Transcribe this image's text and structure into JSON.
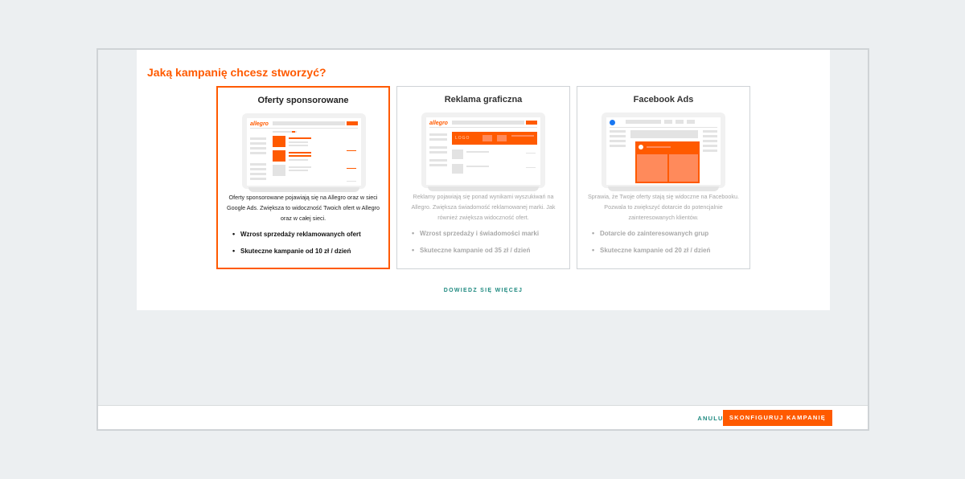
{
  "title": "Jaką kampanię chcesz stworzyć?",
  "cards": [
    {
      "title": "Oferty sponsorowane",
      "logo": "allegro",
      "description": "Oferty sponsorowane pojawiają się na Allegro oraz w sieci Google Ads. Zwiększa to widoczność Twoich ofert w Allegro oraz w całej sieci.",
      "bullets": [
        "Wzrost sprzedaży reklamowanych ofert",
        "Skuteczne kampanie od 10 zł / dzień"
      ]
    },
    {
      "title": "Reklama graficzna",
      "logo": "allegro",
      "banner_text": "LOGO",
      "description": "Reklamy pojawiają się ponad wynikami wyszukiwań na Allegro. Zwiększa świadomość reklamowanej marki. Jak również zwiększa widoczność ofert.",
      "bullets": [
        "Wzrost sprzedaży i świadomości marki",
        "Skuteczne kampanie od 35 zł / dzień"
      ]
    },
    {
      "title": "Facebook Ads",
      "icon": "facebook-icon",
      "description": "Sprawia, że Twoje oferty stają się widoczne na Facebooku. Pozwala to zwiększyć dotarcie do potencjalnie zainteresowanych klientów.",
      "bullets": [
        "Dotarcie do zainteresowanych grup",
        "Skuteczne kampanie od 20 zł / dzień"
      ]
    }
  ],
  "learn_more": "DOWIEDZ SIĘ WIĘCEJ",
  "footer": {
    "cancel": "ANULUJ",
    "configure": "SKONFIGURUJ KAMPANIĘ"
  },
  "colors": {
    "accent": "#ff5a00",
    "link": "#1f8a80",
    "facebook": "#1877f2"
  }
}
